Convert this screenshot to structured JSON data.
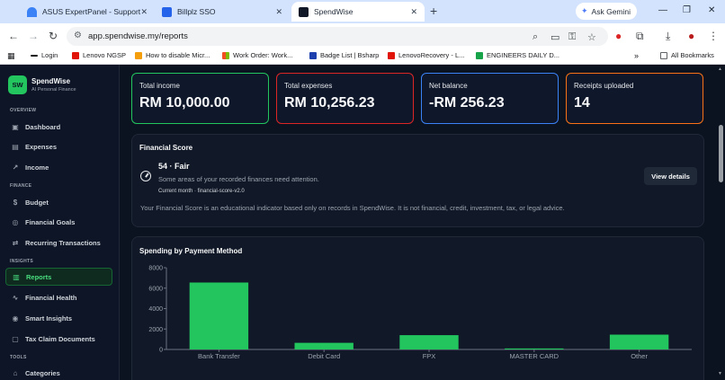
{
  "browser": {
    "tabs": [
      {
        "title": "ASUS ExpertPanel - Support",
        "active": false
      },
      {
        "title": "Billplz SSO",
        "active": false
      },
      {
        "title": "SpendWise",
        "active": true
      }
    ],
    "ask_gemini": "Ask Gemini",
    "url": "app.spendwise.my/reports",
    "bookmarks": [
      "Login",
      "Lenovo NGSP",
      "How to disable Micr...",
      "Work Order: Work...",
      "Badge List | Bsharp",
      "LenovoRecovery - L...",
      "ENGINEERS DAILY D..."
    ],
    "all_bookmarks": "All Bookmarks"
  },
  "sidebar": {
    "logo": "SW",
    "brand": "SpendWise",
    "tagline": "AI Personal Finance",
    "sections": [
      {
        "title": "OVERVIEW",
        "items": [
          {
            "label": "Dashboard",
            "icon": "dashboard-icon"
          },
          {
            "label": "Expenses",
            "icon": "receipt-icon"
          },
          {
            "label": "Income",
            "icon": "trend-up-icon"
          }
        ]
      },
      {
        "title": "FINANCE",
        "items": [
          {
            "label": "Budget",
            "icon": "dollar-icon"
          },
          {
            "label": "Financial Goals",
            "icon": "target-icon"
          },
          {
            "label": "Recurring Transactions",
            "icon": "repeat-icon"
          }
        ]
      },
      {
        "title": "INSIGHTS",
        "items": [
          {
            "label": "Reports",
            "icon": "chart-icon",
            "active": true
          },
          {
            "label": "Financial Health",
            "icon": "pulse-icon"
          },
          {
            "label": "Smart Insights",
            "icon": "bulb-icon"
          },
          {
            "label": "Tax Claim Documents",
            "icon": "document-icon"
          }
        ]
      },
      {
        "title": "TOOLS",
        "items": [
          {
            "label": "Categories",
            "icon": "tag-icon"
          }
        ]
      }
    ]
  },
  "stats": [
    {
      "label": "Total income",
      "value": "RM 10,000.00",
      "border": "#22c55e"
    },
    {
      "label": "Total expenses",
      "value": "RM 10,256.23",
      "border": "#dc2626"
    },
    {
      "label": "Net balance",
      "value": "-RM 256.23",
      "border": "#3b82f6"
    },
    {
      "label": "Receipts uploaded",
      "value": "14",
      "border": "#f97316"
    }
  ],
  "financial_score": {
    "title": "Financial Score",
    "score_line": "54 · Fair",
    "note": "Some areas of your recorded finances need attention.",
    "meta": "Current month · financial-score-v2.0",
    "button": "View details",
    "disclaimer": "Your Financial Score is an educational indicator based only on records in SpendWise. It is not financial, credit, investment, tax, or legal advice."
  },
  "chart_panel": {
    "title": "Spending by Payment Method"
  },
  "chart_data": {
    "type": "bar",
    "title": "Spending by Payment Method",
    "categories": [
      "Bank Transfer",
      "Debit Card",
      "FPX",
      "MASTER CARD",
      "Other"
    ],
    "values": [
      6550,
      650,
      1400,
      100,
      1450
    ],
    "ylim": [
      0,
      8000
    ],
    "yticks": [
      0,
      2000,
      4000,
      6000,
      8000
    ],
    "grid": false,
    "legend": "none",
    "bar_color": "#22c55e"
  }
}
